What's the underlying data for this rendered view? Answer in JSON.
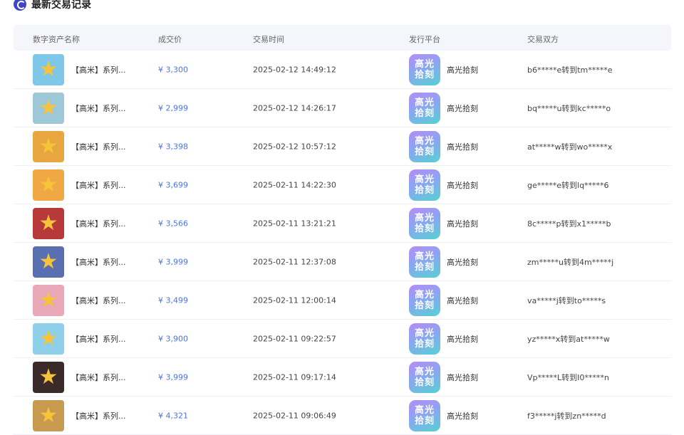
{
  "header": {
    "title": "最新交易记录"
  },
  "table": {
    "columns": [
      "数字资产名称",
      "成交价",
      "交易时间",
      "发行平台",
      "交易双方"
    ],
    "platform_logo_lines": [
      "高光",
      "拾刻"
    ],
    "rows": [
      {
        "name": "【高米】系列...",
        "price": "¥ 3,300",
        "time": "2025-02-12 14:49:12",
        "platform": "高光拾刻",
        "parties": "b6*****e转到tm*****e",
        "thumb_bg": "#7fc7e8"
      },
      {
        "name": "【高米】系列...",
        "price": "¥ 2,999",
        "time": "2025-02-12 14:26:17",
        "platform": "高光拾刻",
        "parties": "bq*****u转到kc*****o",
        "thumb_bg": "#9ec8d8"
      },
      {
        "name": "【高米】系列...",
        "price": "¥ 3,398",
        "time": "2025-02-12 10:57:12",
        "platform": "高光拾刻",
        "parties": "at*****w转到wo*****x",
        "thumb_bg": "#e8a640"
      },
      {
        "name": "【高米】系列...",
        "price": "¥ 3,699",
        "time": "2025-02-11 14:22:30",
        "platform": "高光拾刻",
        "parties": "ge*****e转到lq*****6",
        "thumb_bg": "#f0a844"
      },
      {
        "name": "【高米】系列...",
        "price": "¥ 3,566",
        "time": "2025-02-11 13:21:21",
        "platform": "高光拾刻",
        "parties": "8c*****p转到x1*****b",
        "thumb_bg": "#b8393a"
      },
      {
        "name": "【高米】系列...",
        "price": "¥ 3,999",
        "time": "2025-02-11 12:37:08",
        "platform": "高光拾刻",
        "parties": "zm*****u转到4m*****j",
        "thumb_bg": "#5a6fb0"
      },
      {
        "name": "【高米】系列...",
        "price": "¥ 3,499",
        "time": "2025-02-11 12:00:14",
        "platform": "高光拾刻",
        "parties": "va*****j转到to*****s",
        "thumb_bg": "#e8a8b8"
      },
      {
        "name": "【高米】系列...",
        "price": "¥ 3,900",
        "time": "2025-02-11 09:22:57",
        "platform": "高光拾刻",
        "parties": "yz*****x转到at*****w",
        "thumb_bg": "#8ed0ea"
      },
      {
        "name": "【高米】系列...",
        "price": "¥ 3,999",
        "time": "2025-02-11 09:17:14",
        "platform": "高光拾刻",
        "parties": "Vp*****L转到I0*****n",
        "thumb_bg": "#3a2a2a"
      },
      {
        "name": "【高米】系列...",
        "price": "¥ 4,321",
        "time": "2025-02-11 09:06:49",
        "platform": "高光拾刻",
        "parties": "f3*****j转到zn*****d",
        "thumb_bg": "#c89a50"
      }
    ]
  }
}
